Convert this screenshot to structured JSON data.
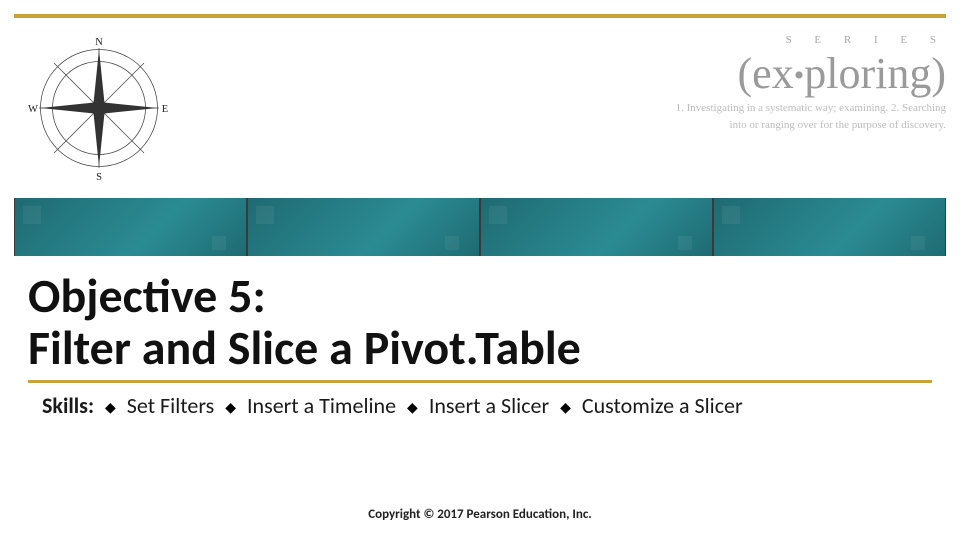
{
  "brand": {
    "series_label": "S E R I E S",
    "logo_text": "(ex.ploring)",
    "sub_line1": "1. Investigating in a systematic way; examining. 2. Searching",
    "sub_line2": "into or ranging over for the purpose of discovery."
  },
  "compass": {
    "n": "N",
    "e": "E",
    "s": "S",
    "w": "W"
  },
  "title": {
    "line1": "Objective 5:",
    "line2": "Filter and Slice a Pivot.Table"
  },
  "skills": {
    "label": "Skills:",
    "items": [
      "Set Filters",
      "Insert a Timeline",
      "Insert a Slicer",
      "Customize a Slicer"
    ],
    "bullet": "◆"
  },
  "footer": {
    "copyright": "Copyright © 2017 Pearson Education, Inc."
  }
}
